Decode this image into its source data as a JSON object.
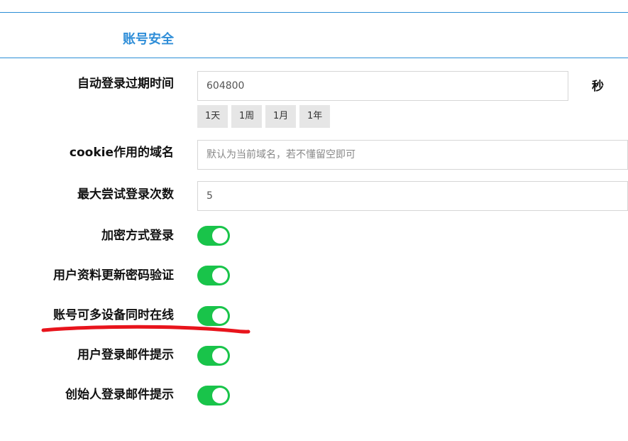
{
  "section": {
    "title": "账号安全"
  },
  "fields": {
    "auto_login_expire": {
      "label": "自动登录过期时间",
      "value": "604800",
      "unit": "秒",
      "quick_options": [
        "1天",
        "1周",
        "1月",
        "1年"
      ]
    },
    "cookie_domain": {
      "label": "cookie作用的域名",
      "value": "",
      "placeholder": "默认为当前域名，若不懂留空即可"
    },
    "max_login_attempts": {
      "label": "最大尝试登录次数",
      "value": "5"
    }
  },
  "toggles": [
    {
      "label": "加密方式登录",
      "on": true
    },
    {
      "label": "用户资料更新密码验证",
      "on": true
    },
    {
      "label": "账号可多设备同时在线",
      "on": true
    },
    {
      "label": "用户登录邮件提示",
      "on": true
    },
    {
      "label": "创始人登录邮件提示",
      "on": true
    }
  ],
  "colors": {
    "accent": "#2f8ed8",
    "toggle_on": "#19c44a",
    "annotation": "#e8141c"
  }
}
